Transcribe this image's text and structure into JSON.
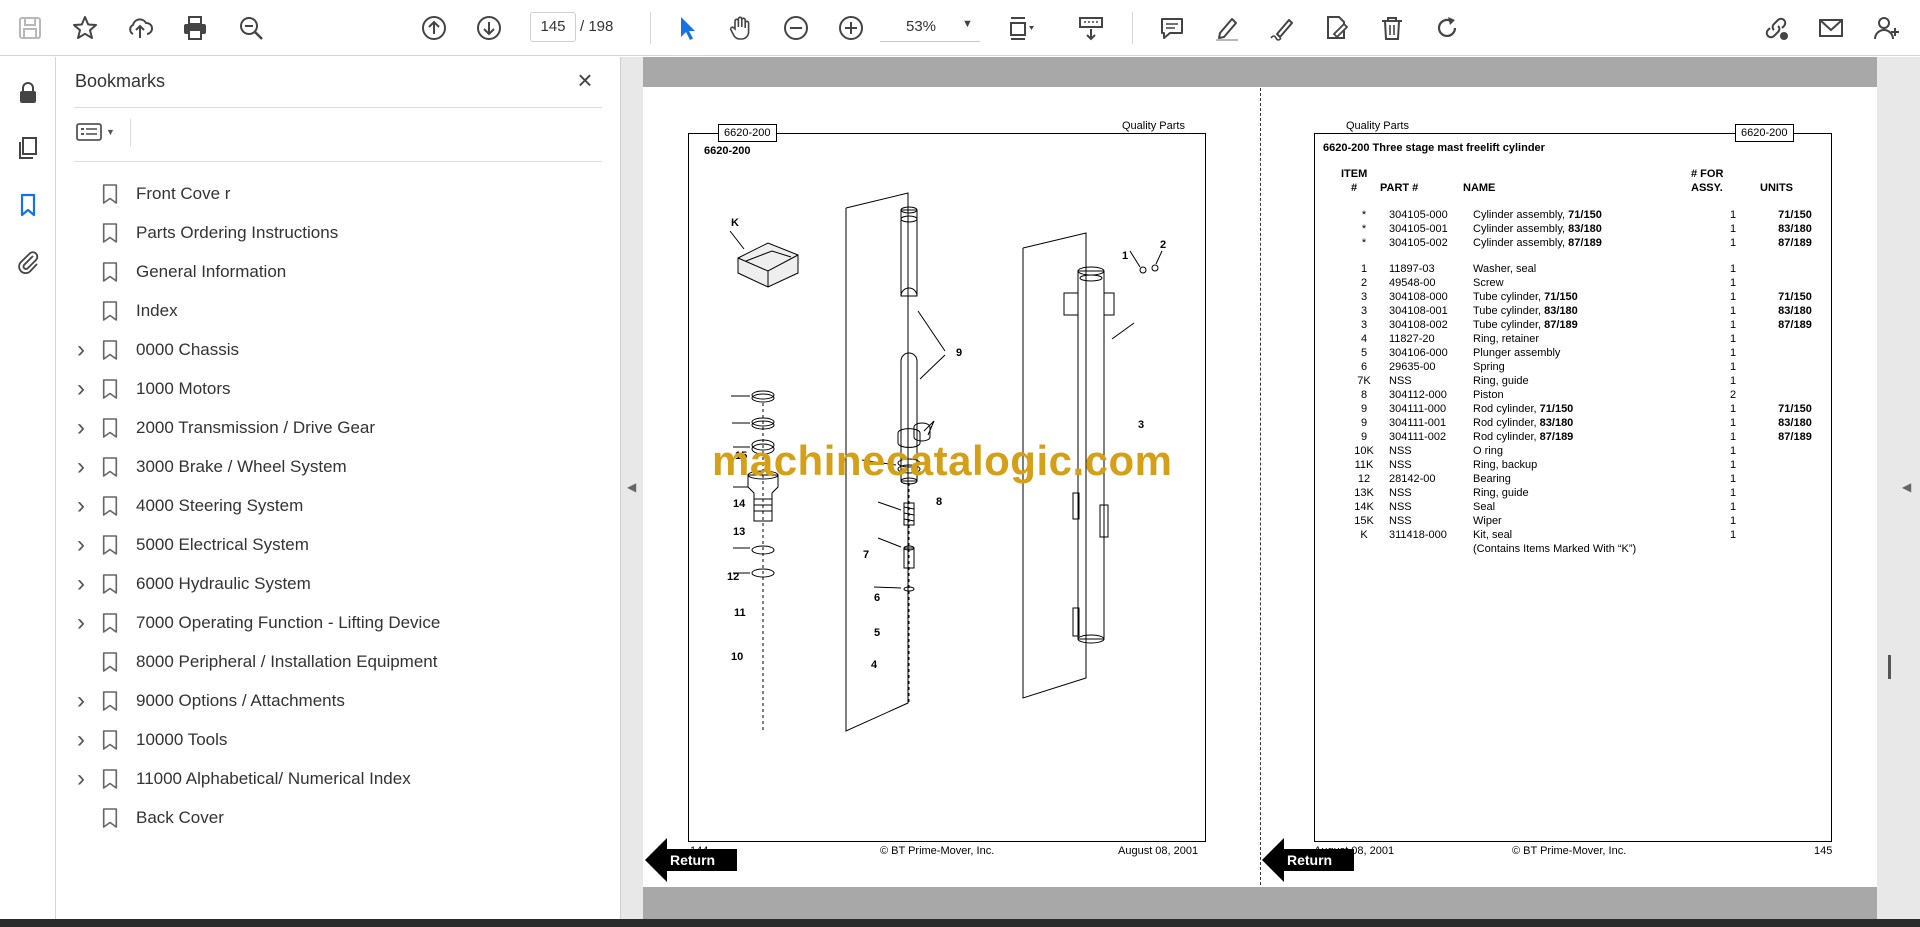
{
  "toolbar": {
    "page_current": "145",
    "page_total": "/  198",
    "zoom": "53%"
  },
  "bookmarks": {
    "title": "Bookmarks",
    "items": [
      {
        "label": "Front Cove r",
        "expandable": false
      },
      {
        "label": "Parts Ordering Instructions",
        "expandable": false
      },
      {
        "label": "General Information",
        "expandable": false
      },
      {
        "label": "Index",
        "expandable": false
      },
      {
        "label": "0000 Chassis",
        "expandable": true
      },
      {
        "label": "1000 Motors",
        "expandable": true
      },
      {
        "label": "2000 Transmission / Drive Gear",
        "expandable": true
      },
      {
        "label": "3000 Brake / Wheel System",
        "expandable": true
      },
      {
        "label": "4000 Steering System",
        "expandable": true
      },
      {
        "label": "5000 Electrical System",
        "expandable": true
      },
      {
        "label": "6000 Hydraulic System",
        "expandable": true
      },
      {
        "label": "7000 Operating Function - Lifting Device",
        "expandable": true
      },
      {
        "label": "8000 Peripheral / Installation Equipment",
        "expandable": false
      },
      {
        "label": "9000 Options / Attachments",
        "expandable": true
      },
      {
        "label": "10000 Tools",
        "expandable": true
      },
      {
        "label": "11000 Alphabetical/ Numerical Index",
        "expandable": true
      },
      {
        "label": "Back Cover",
        "expandable": false
      }
    ]
  },
  "left_page": {
    "tag": "6620-200",
    "header_right": "Quality Parts",
    "subtitle": "6620-200",
    "page_number": "144",
    "copyright": "© BT Prime-Mover, Inc.",
    "date": "August 08, 2001",
    "return_label": "Return",
    "callouts": [
      "K",
      "9",
      "1",
      "2",
      "3",
      "14",
      "13",
      "12",
      "11",
      "10",
      "8",
      "7",
      "6",
      "5",
      "4",
      "15"
    ]
  },
  "watermark": "machinecatalogic.com",
  "right_page": {
    "header_left": "Quality Parts",
    "tag": "6620-200",
    "title": "6620-200 Three stage mast freelift cylinder",
    "col_item_line1": "ITEM",
    "col_item_line2": "#",
    "col_part": "PART #",
    "col_name": "NAME",
    "col_qty_line1": "# FOR",
    "col_qty_line2": "ASSY.",
    "col_units": "UNITS",
    "rows_group1": [
      {
        "item": "*",
        "part": "304105-000",
        "name": "Cylinder assembly, ",
        "name_bold": "71/150",
        "qty": "1",
        "units": "71/150"
      },
      {
        "item": "*",
        "part": "304105-001",
        "name": "Cylinder assembly, ",
        "name_bold": "83/180",
        "qty": "1",
        "units": "83/180"
      },
      {
        "item": "*",
        "part": "304105-002",
        "name": "Cylinder assembly, ",
        "name_bold": "87/189",
        "qty": "1",
        "units": "87/189"
      }
    ],
    "rows_group2": [
      {
        "item": "1",
        "part": "11897-03",
        "name": "Washer, seal",
        "name_bold": "",
        "qty": "1",
        "units": ""
      },
      {
        "item": "2",
        "part": "49548-00",
        "name": "Screw",
        "name_bold": "",
        "qty": "1",
        "units": ""
      },
      {
        "item": "3",
        "part": "304108-000",
        "name": "Tube cylinder, ",
        "name_bold": "71/150",
        "qty": "1",
        "units": "71/150"
      },
      {
        "item": "3",
        "part": "304108-001",
        "name": "Tube cylinder, ",
        "name_bold": "83/180",
        "qty": "1",
        "units": "83/180"
      },
      {
        "item": "3",
        "part": "304108-002",
        "name": "Tube cylinder, ",
        "name_bold": "87/189",
        "qty": "1",
        "units": "87/189"
      },
      {
        "item": "4",
        "part": "11827-20",
        "name": "Ring, retainer",
        "name_bold": "",
        "qty": "1",
        "units": ""
      },
      {
        "item": "5",
        "part": "304106-000",
        "name": "Plunger assembly",
        "name_bold": "",
        "qty": "1",
        "units": ""
      },
      {
        "item": "6",
        "part": "29635-00",
        "name": "Spring",
        "name_bold": "",
        "qty": "1",
        "units": ""
      },
      {
        "item": "7K",
        "part": "NSS",
        "name": "Ring, guide",
        "name_bold": "",
        "qty": "1",
        "units": ""
      },
      {
        "item": "8",
        "part": "304112-000",
        "name": "Piston",
        "name_bold": "",
        "qty": "2",
        "units": ""
      },
      {
        "item": "9",
        "part": "304111-000",
        "name": "Rod cylinder, ",
        "name_bold": "71/150",
        "qty": "1",
        "units": "71/150"
      },
      {
        "item": "9",
        "part": "304111-001",
        "name": "Rod cylinder, ",
        "name_bold": "83/180",
        "qty": "1",
        "units": "83/180"
      },
      {
        "item": "9",
        "part": "304111-002",
        "name": "Rod cylinder, ",
        "name_bold": "87/189",
        "qty": "1",
        "units": "87/189"
      },
      {
        "item": "10K",
        "part": "NSS",
        "name": "O ring",
        "name_bold": "",
        "qty": "1",
        "units": ""
      },
      {
        "item": "11K",
        "part": "NSS",
        "name": "Ring, backup",
        "name_bold": "",
        "qty": "1",
        "units": ""
      },
      {
        "item": "12",
        "part": "28142-00",
        "name": "Bearing",
        "name_bold": "",
        "qty": "1",
        "units": ""
      },
      {
        "item": "13K",
        "part": "NSS",
        "name": "Ring, guide",
        "name_bold": "",
        "qty": "1",
        "units": ""
      },
      {
        "item": "14K",
        "part": "NSS",
        "name": "Seal",
        "name_bold": "",
        "qty": "1",
        "units": ""
      },
      {
        "item": "15K",
        "part": "NSS",
        "name": "Wiper",
        "name_bold": "",
        "qty": "1",
        "units": ""
      },
      {
        "item": "K",
        "part": "311418-000",
        "name": "Kit, seal",
        "name_bold": "",
        "qty": "1",
        "units": ""
      },
      {
        "item": "",
        "part": "",
        "name": "(Contains Items Marked With “K”)",
        "name_bold": "",
        "qty": "",
        "units": ""
      }
    ],
    "date": "August 08, 2001",
    "copyright": "© BT Prime-Mover, Inc.",
    "page_number": "145",
    "return_label": "Return"
  }
}
